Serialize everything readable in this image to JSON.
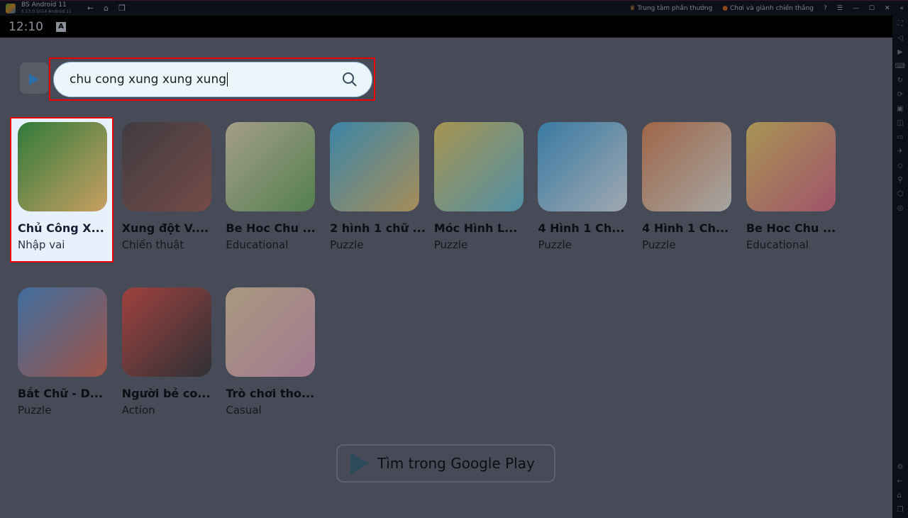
{
  "window": {
    "title": "BS Android 11",
    "subtitle": "5.13.0.1014  Android 11",
    "rewards": "Trung tâm phần thưởng",
    "play_win": "Chơi và giành chiến thắng"
  },
  "status": {
    "time": "12:10",
    "badge": "A"
  },
  "search": {
    "value": "chu cong xung xung xung"
  },
  "apps": [
    {
      "name": "Chủ Công X...",
      "category": "Nhập vai",
      "colors": [
        "#2f7a3a",
        "#c9a062"
      ],
      "selected": true
    },
    {
      "name": "Xung đột V....",
      "category": "Chiến thuật",
      "colors": [
        "#3a3030",
        "#9c4a3a"
      ]
    },
    {
      "name": "Be Hoc Chu ...",
      "category": "Educational",
      "colors": [
        "#f2e3b0",
        "#5ea84a"
      ]
    },
    {
      "name": "2 hình 1 chữ ...",
      "category": "Puzzle",
      "colors": [
        "#34b5e8",
        "#f6c35a"
      ]
    },
    {
      "name": "Móc Hình L...",
      "category": "Puzzle",
      "colors": [
        "#f4d04a",
        "#5ac8e8"
      ]
    },
    {
      "name": "4 Hình 1 Ch...",
      "category": "Puzzle",
      "colors": [
        "#2fa0e0",
        "#e8f4fa"
      ]
    },
    {
      "name": "4 Hình 1 Ch...",
      "category": "Puzzle",
      "colors": [
        "#e87a3a",
        "#f4f0e0"
      ]
    },
    {
      "name": "Be Hoc Chu ...",
      "category": "Educational",
      "colors": [
        "#f8d050",
        "#e85a7a"
      ]
    },
    {
      "name": "Bắt Chữ - D...",
      "category": "Puzzle",
      "colors": [
        "#3a8ad8",
        "#e85a3a"
      ]
    },
    {
      "name": "Người bẻ co...",
      "category": "Action",
      "colors": [
        "#e83a2a",
        "#1a1a1a"
      ]
    },
    {
      "name": "Trò chơi tho...",
      "category": "Casual",
      "colors": [
        "#f8d8a0",
        "#f0a0c0"
      ]
    }
  ],
  "google_play_button": "Tìm trong Google Play"
}
